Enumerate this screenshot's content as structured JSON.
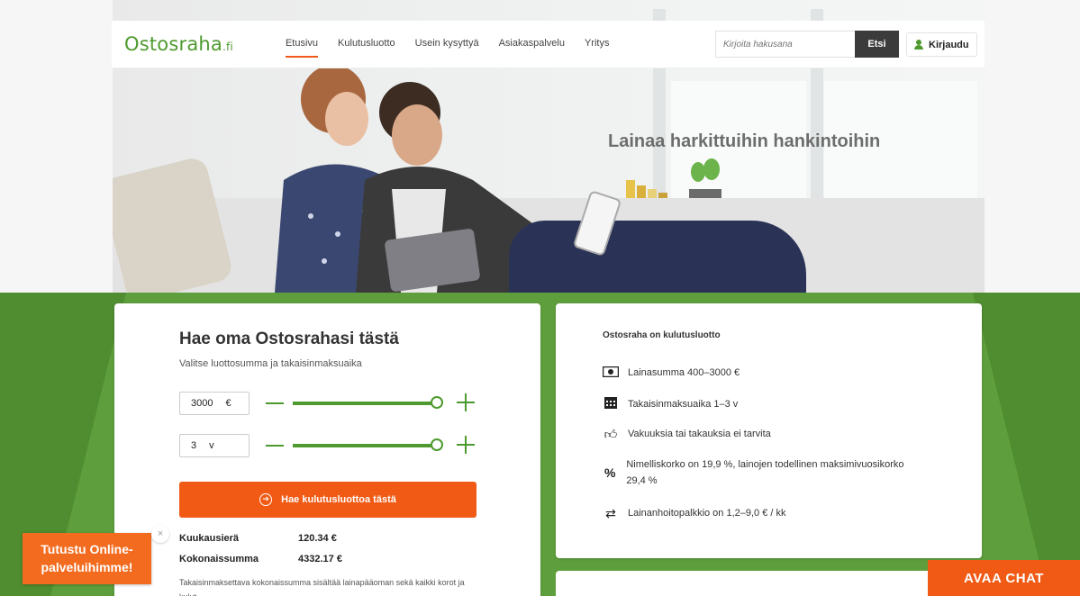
{
  "header": {
    "logo": "Ostosraha",
    "logo_suffix": ".fi",
    "nav": [
      {
        "label": "Etusivu",
        "active": true
      },
      {
        "label": "Kulutusluotto",
        "active": false
      },
      {
        "label": "Usein kysyttyä",
        "active": false
      },
      {
        "label": "Asiakaspalvelu",
        "active": false
      },
      {
        "label": "Yritys",
        "active": false
      }
    ],
    "search_placeholder": "Kirjoita hakusana",
    "search_button": "Etsi",
    "login_label": "Kirjaudu"
  },
  "hero": {
    "title": "Lainaa harkittuihin hankintoihin"
  },
  "calculator": {
    "title": "Hae oma Ostosrahasi tästä",
    "subtitle": "Valitse luottosumma ja takaisinmaksuaika",
    "amount": {
      "value": "3000",
      "unit": "€",
      "level": 1.0
    },
    "term": {
      "value": "3",
      "unit": "v",
      "level": 1.0
    },
    "apply_button": "Hae kulutusluottoa tästä",
    "monthly_label": "Kuukausierä",
    "monthly_value": "120.34 €",
    "total_label": "Kokonaissumma",
    "total_value": "4332.17 €",
    "note": "Takaisinmaksettava kokonaissumma sisältää lainapääoman sekä kaikki korot ja kulut."
  },
  "info": {
    "title": "Ostosraha on kulutusluotto",
    "items": [
      {
        "icon": "money-icon",
        "text": "Lainasumma 400–3000 €"
      },
      {
        "icon": "calendar-icon",
        "text": "Takaisinmaksuaika 1–3 v"
      },
      {
        "icon": "thumbs-up-icon",
        "text": "Vakuuksia tai takauksia ei tarvita"
      },
      {
        "icon": "percent-icon",
        "text": "Nimelliskorko on 19,9 %, lainojen todellinen maksimivuosikorko 29,4 %"
      },
      {
        "icon": "transfer-icon",
        "text": "Lainanhoitopalkkio on 1,2–9,0 € / kk"
      }
    ]
  },
  "promo": {
    "label": "Tutustu Online-palveluihimme!",
    "close": "×"
  },
  "chat": {
    "label": "AVAA CHAT"
  },
  "colors": {
    "brand_green": "#4e9a2e",
    "accent_orange": "#f15a14",
    "background_green": "#5e9e3c"
  }
}
